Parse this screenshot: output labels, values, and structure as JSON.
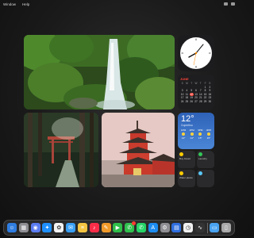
{
  "menubar": {
    "items": [
      "Window",
      "Help"
    ]
  },
  "photos": [
    {
      "name": "waterfall-forest"
    },
    {
      "name": "torii-path"
    },
    {
      "name": "pagoda-temple"
    }
  ],
  "calendar": {
    "month": "JUNE",
    "dow": [
      "S",
      "M",
      "T",
      "W",
      "T",
      "F",
      "S"
    ],
    "days": [
      "",
      "",
      "",
      "",
      "",
      "1",
      "2",
      "3",
      "4",
      "5",
      "6",
      "7",
      "8",
      "9",
      "10",
      "11",
      "12",
      "13",
      "14",
      "15",
      "16",
      "17",
      "18",
      "19",
      "20",
      "21",
      "22",
      "23",
      "24",
      "25",
      "26",
      "27",
      "28",
      "29",
      "30"
    ],
    "today": "12"
  },
  "weather": {
    "temp": "12°",
    "location": "Cupertino",
    "forecast": [
      {
        "time": "1PM",
        "temp": "13°"
      },
      {
        "time": "2PM",
        "temp": "14°"
      },
      {
        "time": "3PM",
        "temp": "15°"
      },
      {
        "time": "4PM",
        "temp": "15°"
      }
    ]
  },
  "reminders": [
    {
      "label": "Buy bread",
      "color": "#ffcc00"
    },
    {
      "label": "Laundry",
      "color": "#34c759"
    },
    {
      "label": "Water plants",
      "color": "#ffcc00"
    },
    {
      "label": "",
      "color": "#5ac8fa"
    }
  ],
  "dock": {
    "apps": [
      {
        "name": "finder",
        "color": "#2f7de1",
        "glyph": "☺"
      },
      {
        "name": "launchpad",
        "color": "#8e8e93",
        "glyph": "▦"
      },
      {
        "name": "messenger",
        "color": "#5b7cf0",
        "glyph": "◉"
      },
      {
        "name": "safari",
        "color": "#1e90ff",
        "glyph": "✦"
      },
      {
        "name": "photos",
        "color": "#f3f3f3",
        "glyph": "✿"
      },
      {
        "name": "mail",
        "color": "#3aa0f5",
        "glyph": "✉"
      },
      {
        "name": "notes",
        "color": "#f5c542",
        "glyph": "≡"
      },
      {
        "name": "music",
        "color": "#fa2d48",
        "glyph": "♪"
      },
      {
        "name": "pages",
        "color": "#f09a2a",
        "glyph": "✎"
      },
      {
        "name": "facetime",
        "color": "#2fbf4a",
        "glyph": "▶"
      },
      {
        "name": "messages",
        "color": "#30c04e",
        "glyph": "✆",
        "badge": true
      },
      {
        "name": "whatsapp",
        "color": "#25d366",
        "glyph": "✆"
      },
      {
        "name": "app-store",
        "color": "#1c8cf0",
        "glyph": "A"
      },
      {
        "name": "settings",
        "color": "#8e8e93",
        "glyph": "⚙"
      },
      {
        "name": "keynote",
        "color": "#2f6fe0",
        "glyph": "▤"
      },
      {
        "name": "clock",
        "color": "#f0f0f0",
        "glyph": "◷"
      },
      {
        "name": "activity",
        "color": "#333333",
        "glyph": "∿"
      }
    ],
    "trailing": [
      {
        "name": "folder",
        "color": "#4aa3f0",
        "glyph": "▭"
      },
      {
        "name": "trash",
        "color": "#aaaaaa",
        "glyph": "▯"
      }
    ]
  }
}
